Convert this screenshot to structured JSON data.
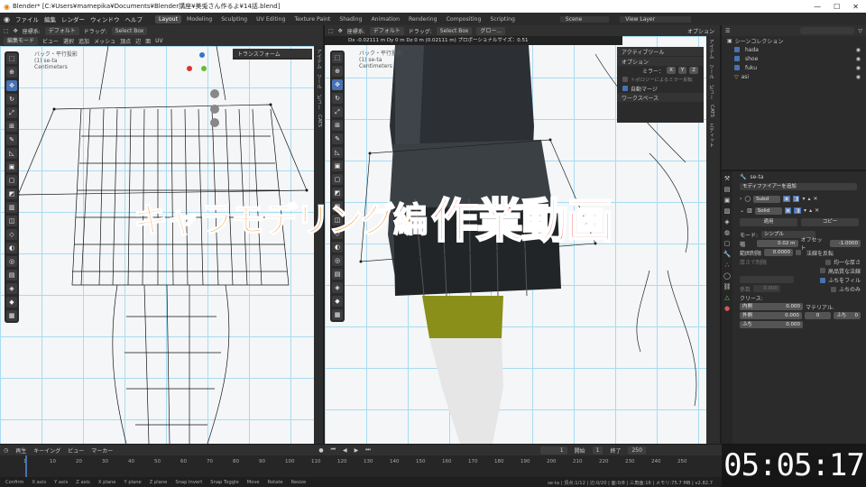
{
  "titlebar": {
    "title": "Blender* [C:¥Users¥mamepika¥Documents¥Blender講座¥美兎さん作るよ¥14話.blend]",
    "min": "—",
    "max": "☐",
    "close": "✕"
  },
  "menu": {
    "items": [
      "ファイル",
      "編集",
      "レンダー",
      "ウィンドウ",
      "ヘルプ"
    ],
    "workspaces": [
      "Layout",
      "Modeling",
      "Sculpting",
      "UV Editing",
      "Texture Paint",
      "Shading",
      "Animation",
      "Rendering",
      "Compositing",
      "Scripting"
    ],
    "scene": "Scene",
    "view_layer": "View Layer"
  },
  "left_vp": {
    "mode": "編集モード",
    "menus": [
      "ビュー",
      "選択",
      "追加",
      "メッシュ",
      "頂点",
      "辺",
      "面",
      "UV"
    ],
    "coord": "座標系:",
    "coord_val": "デフォルト",
    "drag": "ドラッグ:",
    "select": "Select Box",
    "overlay_title": "バック・平行投影",
    "overlay_sub": "(1) se-ta",
    "overlay_unit": "Centimeters",
    "tabs": [
      "アイテム",
      "ツール",
      "ビュー",
      "CATS"
    ],
    "transform_panel": "トランスフォーム"
  },
  "right_vp": {
    "coord": "座標系:",
    "coord_val": "デフォルト",
    "drag": "ドラッグ:",
    "select": "Select Box",
    "global": "グロー...",
    "options": "オプション",
    "status": "Dx -0.02111 m  Dy 0 m  Dz 0 m (0.02111 m)  プロポーショナルサイズ：0.51",
    "overlay_title": "バック・平行投影",
    "overlay_sub": "(1) se-ta",
    "overlay_unit": "Centimeters",
    "active_tool": "アクティブツール",
    "options_hdr": "オプション",
    "mirror": "ミラー：",
    "axes": [
      "X",
      "Y",
      "Z"
    ],
    "topo": "トポロジーによるミラー反転",
    "automerge": "自動マージ",
    "workspace": "ワークスペース",
    "tabs": [
      "アイテム",
      "ツール",
      "ビュー",
      "CATS",
      "エディット"
    ]
  },
  "caption": {
    "part1": "キャラモデリング編",
    "part2": "作業動画"
  },
  "outliner": {
    "title": "シーンコレクション",
    "items": [
      "hada",
      "shoe",
      "fuku",
      "asi"
    ]
  },
  "properties": {
    "object": "se-ta",
    "add_modifier": "モディファイアーを追加",
    "mods": [
      {
        "name": "Subd"
      },
      {
        "name": "Solid"
      }
    ],
    "apply": "適用",
    "copy": "コピー",
    "mode_label": "モード:",
    "mode_val": "シンプル",
    "width_label": "幅",
    "width_val": "0.02 m",
    "offset_label": "オフセット",
    "offset_val": "-1.0000",
    "clamp_label": "範囲制限",
    "clamp_val": "0.0000",
    "checks": [
      "法線を反転",
      "均一な厚さ",
      "高品質な法線",
      "ふちをフィル",
      "ふちのみ"
    ],
    "checks_on": [
      false,
      false,
      false,
      true,
      false
    ],
    "check_clamp": "厚さで制限",
    "vgroup": "頂点グループ",
    "factor": "係数",
    "factor_val": "0.000",
    "crease": "クリース:",
    "inner": "内側",
    "inner_val": "0.000",
    "outer": "外側",
    "outer_val": "0.000",
    "rim": "ふち",
    "rim_val": "0.000",
    "material": "マテリアル.",
    "mat0": "0",
    "rim2": "ふち",
    "mat1": "0"
  },
  "timeline": {
    "menus": [
      "再生",
      "キーイング",
      "ビュー",
      "マーカー"
    ],
    "current": "1",
    "start_label": "開始",
    "start": "1",
    "end_label": "終了",
    "end": "250",
    "ticks": [
      "1",
      "10",
      "20",
      "30",
      "40",
      "50",
      "60",
      "70",
      "80",
      "90",
      "100",
      "110",
      "120",
      "130",
      "140",
      "150",
      "160",
      "170",
      "180",
      "190",
      "200",
      "210",
      "220",
      "230",
      "240",
      "250"
    ]
  },
  "statusbar": {
    "items": [
      "Confirm",
      "X axis",
      "Y axis",
      "Z axis",
      "X plane",
      "Y plane",
      "Z plane",
      "Snap Invert",
      "Snap Toggle",
      "Move",
      "Rotate",
      "Resize"
    ],
    "right": "se-ta | 頂点:1/12 | 辺:0/20 | 面:0/8 | 三角面:16 | メモリ:75.7 MB | v2.82.7"
  },
  "clock": "05:05:17"
}
